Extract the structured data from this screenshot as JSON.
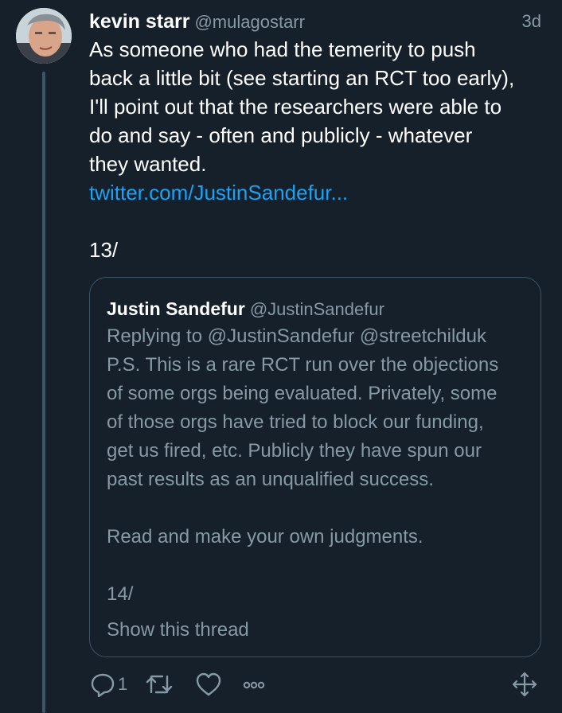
{
  "tweet": {
    "author_name": "kevin starr",
    "author_handle": "@mulagostarr",
    "timestamp": "3d",
    "text_lines": [
      "As someone who had the temerity to push",
      "back a little bit (see starting an RCT too early),",
      "I'll point out that the researchers were able to",
      "do and say - often and publicly - whatever",
      "they wanted."
    ],
    "link": "twitter.com/JustinSandefur...",
    "thread_count": "13/"
  },
  "quote": {
    "author_name": "Justin Sandefur",
    "author_handle": "@JustinSandefur",
    "reply_line": "Replying to @JustinSandefur @streetchilduk",
    "body_lines": [
      "P.S. This is a rare RCT run over the objections",
      "of some orgs being evaluated. Privately, some",
      "of those orgs have tried to block our funding,",
      "get us fired, etc. Publicly they have spun our",
      "past results as an unqualified success."
    ],
    "closing": "Read and make your own judgments.",
    "thread_count": "14/",
    "show_thread": "Show this thread"
  },
  "actions": {
    "reply_count": "1",
    "icons": [
      "reply-icon",
      "retweet-icon",
      "like-icon",
      "more-icon",
      "expand-icon"
    ]
  },
  "colors": {
    "background": "#15202b",
    "secondary_text": "#8899a6",
    "link": "#1da1f2",
    "border": "#3d5466"
  }
}
